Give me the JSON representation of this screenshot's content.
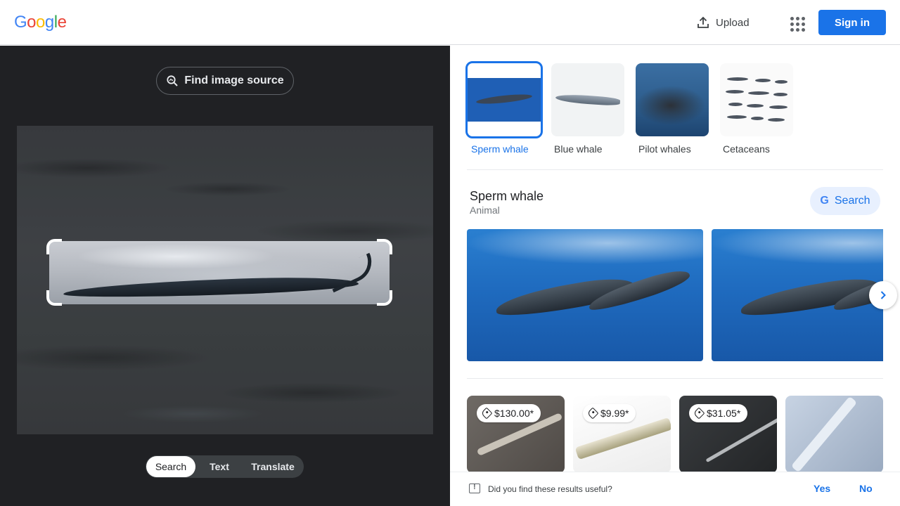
{
  "header": {
    "logo_letters": [
      {
        "char": "G",
        "color": "#4285F4"
      },
      {
        "char": "o",
        "color": "#EA4335"
      },
      {
        "char": "o",
        "color": "#FBBC05"
      },
      {
        "char": "g",
        "color": "#4285F4"
      },
      {
        "char": "l",
        "color": "#34A853"
      },
      {
        "char": "e",
        "color": "#EA4335"
      }
    ],
    "upload_label": "Upload",
    "apps_icon": "apps-grid-icon",
    "signin_label": "Sign in"
  },
  "left": {
    "find_source_label": "Find image source",
    "modes": [
      "Search",
      "Text",
      "Translate"
    ],
    "active_mode": "Search"
  },
  "right": {
    "chips": [
      {
        "label": "Sperm whale",
        "active": true
      },
      {
        "label": "Blue whale",
        "active": false
      },
      {
        "label": "Pilot whales",
        "active": false
      },
      {
        "label": "Cetaceans",
        "active": false
      }
    ],
    "entity": {
      "title": "Sperm whale",
      "subtitle": "Animal",
      "search_label": "Search"
    },
    "products": [
      {
        "price": "$130.00*"
      },
      {
        "price": "$9.99*"
      },
      {
        "price": "$31.05*"
      },
      {
        "price": ""
      }
    ],
    "feedback": {
      "question": "Did you find these results useful?",
      "yes": "Yes",
      "no": "No"
    }
  },
  "colors": {
    "accent": "#1a73e8",
    "left_bg": "#202124"
  }
}
